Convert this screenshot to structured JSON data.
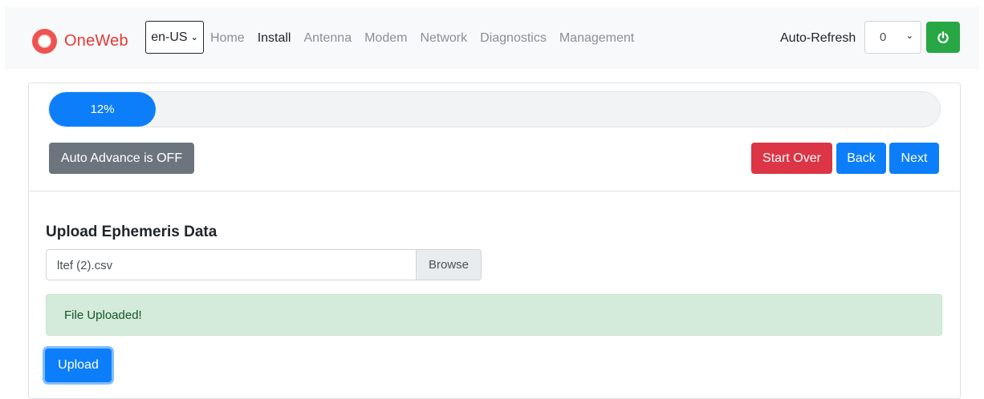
{
  "navbar": {
    "brand": "OneWeb",
    "language": "en-US",
    "links": [
      {
        "label": "Home",
        "active": false
      },
      {
        "label": "Install",
        "active": true
      },
      {
        "label": "Antenna",
        "active": false
      },
      {
        "label": "Modem",
        "active": false
      },
      {
        "label": "Network",
        "active": false
      },
      {
        "label": "Diagnostics",
        "active": false
      },
      {
        "label": "Management",
        "active": false
      }
    ],
    "auto_refresh_label": "Auto-Refresh",
    "auto_refresh_value": "0",
    "power_icon": "power-icon"
  },
  "wizard": {
    "progress_percent": 12,
    "progress_label": "12%",
    "auto_advance_label": "Auto Advance is OFF",
    "start_over_label": "Start Over",
    "back_label": "Back",
    "next_label": "Next"
  },
  "upload": {
    "title": "Upload Ephemeris Data",
    "file_name": "ltef (2).csv",
    "browse_label": "Browse",
    "alert_text": "File Uploaded!",
    "upload_label": "Upload"
  },
  "colors": {
    "brand": "#e53935",
    "primary": "#0d7ef9",
    "danger": "#dc3545",
    "success": "#28a745",
    "secondary": "#6c757d",
    "alert_bg": "#d4eadb"
  }
}
